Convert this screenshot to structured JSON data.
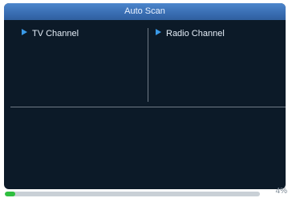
{
  "title": "Auto Scan",
  "columns": {
    "tv": {
      "label": "TV Channel",
      "icon": "triangle-right-icon"
    },
    "radio": {
      "label": "Radio Channel",
      "icon": "triangle-right-icon"
    }
  },
  "progress": {
    "percent": 4,
    "label": "4%",
    "fill_color": "#2fbf3f"
  },
  "colors": {
    "panel_bg": "#0c1a28",
    "title_bar": "#3a6fb4",
    "accent_arrow": "#3a9ae8"
  }
}
